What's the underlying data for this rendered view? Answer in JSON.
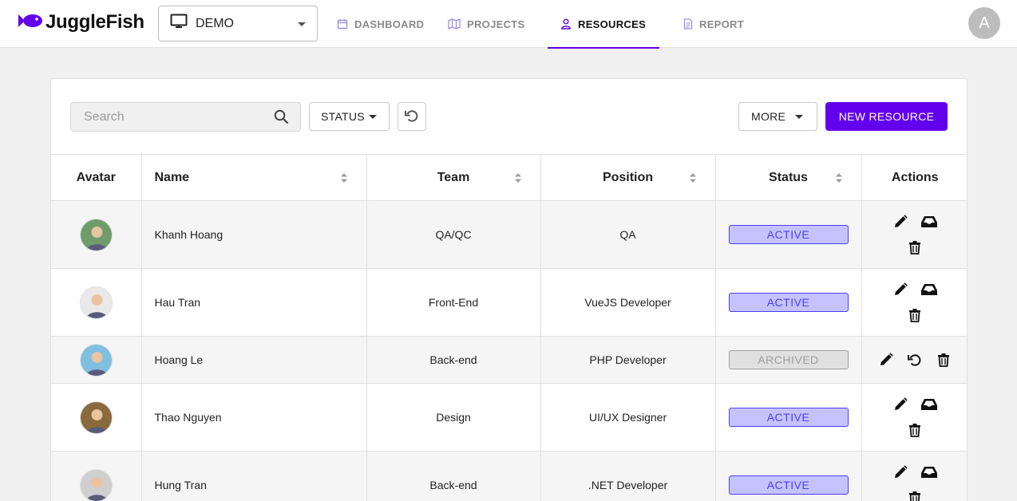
{
  "app": {
    "name": "JuggleFish",
    "brand_color": "#6200ee"
  },
  "project_select": {
    "value": "DEMO",
    "icon": "monitor-icon"
  },
  "nav": [
    {
      "label": "DASHBOARD",
      "icon": "calendar-icon",
      "active": false
    },
    {
      "label": "PROJECTS",
      "icon": "map-icon",
      "active": false
    },
    {
      "label": "RESOURCES",
      "icon": "person-icon",
      "active": true
    },
    {
      "label": "REPORT",
      "icon": "document-icon",
      "active": false
    }
  ],
  "user": {
    "initial": "A"
  },
  "toolbar": {
    "search_placeholder": "Search",
    "status_label": "STATUS",
    "more_label": "MORE",
    "new_label": "NEW RESOURCE"
  },
  "table": {
    "headers": {
      "avatar": "Avatar",
      "name": "Name",
      "team": "Team",
      "position": "Position",
      "status": "Status",
      "actions": "Actions"
    },
    "rows": [
      {
        "name": "Khanh Hoang",
        "team": "QA/QC",
        "position": "QA",
        "status": "ACTIVE",
        "avatar_color": "#6f9c6a"
      },
      {
        "name": "Hau Tran",
        "team": "Front-End",
        "position": "VueJS Developer",
        "status": "ACTIVE",
        "avatar_color": "#e9e9e9"
      },
      {
        "name": "Hoang Le",
        "team": "Back-end",
        "position": "PHP Developer",
        "status": "ARCHIVED",
        "avatar_color": "#7fbfe0"
      },
      {
        "name": "Thao Nguyen",
        "team": "Design",
        "position": "UI/UX Designer",
        "status": "ACTIVE",
        "avatar_color": "#8a6a3c"
      },
      {
        "name": "Hung Tran",
        "team": "Back-end",
        "position": ".NET Developer",
        "status": "ACTIVE",
        "avatar_color": "#cfcfcf"
      }
    ]
  },
  "colors": {
    "active_bg": "#c5c3ff",
    "active_fg": "#4a3dfa",
    "archived_bg": "#e0e0e0",
    "archived_fg": "#9e9e9e"
  }
}
